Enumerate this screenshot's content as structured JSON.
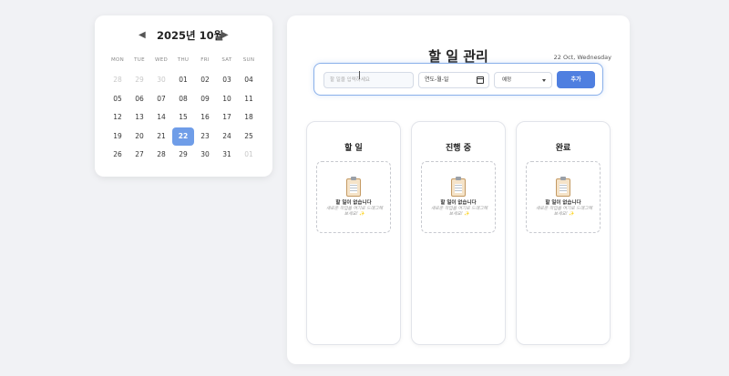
{
  "calendar": {
    "title": "2025년 10월",
    "prev_icon": "chevron-left-icon",
    "next_icon": "chevron-right-icon",
    "weekdays": [
      "MON",
      "TUE",
      "WED",
      "THU",
      "FRI",
      "SAT",
      "SUN"
    ],
    "weeks": [
      [
        {
          "d": "28",
          "m": true
        },
        {
          "d": "29",
          "m": true
        },
        {
          "d": "30",
          "m": true
        },
        {
          "d": "01"
        },
        {
          "d": "02"
        },
        {
          "d": "03"
        },
        {
          "d": "04"
        }
      ],
      [
        {
          "d": "05"
        },
        {
          "d": "06"
        },
        {
          "d": "07"
        },
        {
          "d": "08"
        },
        {
          "d": "09"
        },
        {
          "d": "10"
        },
        {
          "d": "11"
        }
      ],
      [
        {
          "d": "12"
        },
        {
          "d": "13"
        },
        {
          "d": "14"
        },
        {
          "d": "15"
        },
        {
          "d": "16"
        },
        {
          "d": "17"
        },
        {
          "d": "18"
        }
      ],
      [
        {
          "d": "19"
        },
        {
          "d": "20"
        },
        {
          "d": "21"
        },
        {
          "d": "22",
          "today": true
        },
        {
          "d": "23"
        },
        {
          "d": "24"
        },
        {
          "d": "25"
        }
      ],
      [
        {
          "d": "26"
        },
        {
          "d": "27"
        },
        {
          "d": "28"
        },
        {
          "d": "29"
        },
        {
          "d": "30"
        },
        {
          "d": "31"
        },
        {
          "d": "01",
          "m": true
        }
      ]
    ],
    "today_color": "#6f9de8"
  },
  "main": {
    "title": "할 일 관리",
    "date": "22 Oct, Wednesday"
  },
  "form": {
    "task_placeholder": "할 일을 입력하세요",
    "date_value": "연도-월-일",
    "status_value": "예정",
    "add_label": "추가",
    "accent": "#4f7fe0"
  },
  "columns": [
    {
      "title": "할 일",
      "empty_title": "할 일이 없습니다",
      "empty_sub": "새로운 작업을 여기로 드래그해보세요! ✨"
    },
    {
      "title": "진행 중",
      "empty_title": "할 일이 없습니다",
      "empty_sub": "새로운 작업을 여기로 드래그해보세요! ✨"
    },
    {
      "title": "완료",
      "empty_title": "할 일이 없습니다",
      "empty_sub": "새로운 작업을 여기로 드래그해보세요! ✨"
    }
  ]
}
